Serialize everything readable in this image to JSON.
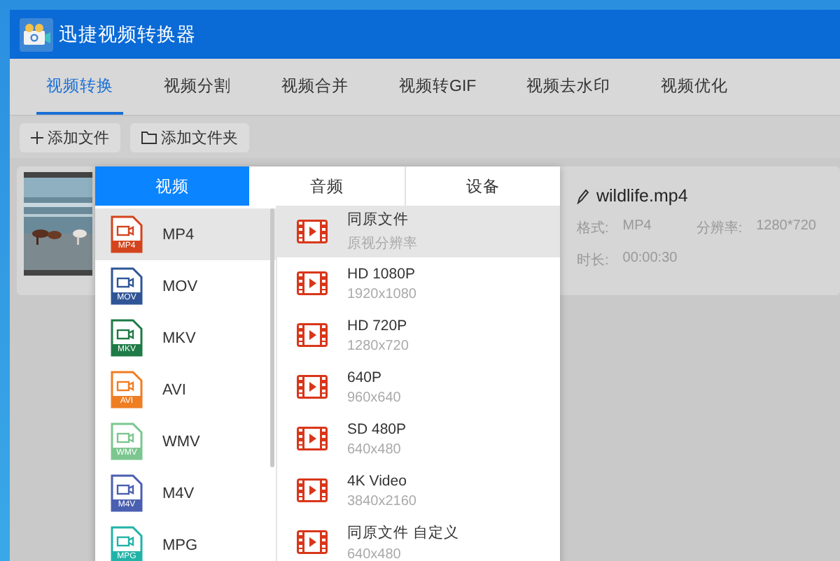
{
  "window": {
    "title": "迅捷视频转换器"
  },
  "tabs": [
    {
      "label": "视频转换",
      "selected": true
    },
    {
      "label": "视频分割",
      "selected": false
    },
    {
      "label": "视频合并",
      "selected": false
    },
    {
      "label": "视频转GIF",
      "selected": false
    },
    {
      "label": "视频去水印",
      "selected": false
    },
    {
      "label": "视频优化",
      "selected": false
    }
  ],
  "toolbar": [
    {
      "label": "添加文件",
      "kind": "plus"
    },
    {
      "label": "添加文件夹",
      "kind": "folder"
    }
  ],
  "file": {
    "name": "wildlife.mp4",
    "format_label": "格式:",
    "format": "MP4",
    "resolution_label": "分辨率:",
    "resolution": "1280*720",
    "duration_label": "时长:",
    "duration": "00:00:30"
  },
  "popup": {
    "tabs": [
      {
        "label": "视频",
        "selected": true
      },
      {
        "label": "音频",
        "selected": false
      },
      {
        "label": "设备",
        "selected": false
      }
    ],
    "formats": [
      {
        "name": "MP4",
        "badge": "MP4",
        "color": "#d4441c",
        "selected": true
      },
      {
        "name": "MOV",
        "badge": "MOV",
        "color": "#2f5597",
        "selected": false
      },
      {
        "name": "MKV",
        "badge": "MKV",
        "color": "#1e7a46",
        "selected": false
      },
      {
        "name": "AVI",
        "badge": "AVI",
        "color": "#ef7d22",
        "selected": false
      },
      {
        "name": "WMV",
        "badge": "WMV",
        "color": "#7cc68f",
        "selected": false
      },
      {
        "name": "M4V",
        "badge": "M4V",
        "color": "#4a5fb0",
        "selected": false
      },
      {
        "name": "MPG",
        "badge": "MPG",
        "color": "#22b3a8",
        "selected": false
      }
    ],
    "presets": [
      {
        "title": "同原文件",
        "detail": "原视分辨率",
        "selected": true
      },
      {
        "title": "HD 1080P",
        "detail": "1920x1080",
        "selected": false
      },
      {
        "title": "HD 720P",
        "detail": "1280x720",
        "selected": false
      },
      {
        "title": "640P",
        "detail": "960x640",
        "selected": false
      },
      {
        "title": "SD 480P",
        "detail": "640x480",
        "selected": false
      },
      {
        "title": "4K Video",
        "detail": "3840x2160",
        "selected": false
      },
      {
        "title": "同原文件 自定义",
        "detail": "640x480",
        "selected": false
      }
    ]
  }
}
